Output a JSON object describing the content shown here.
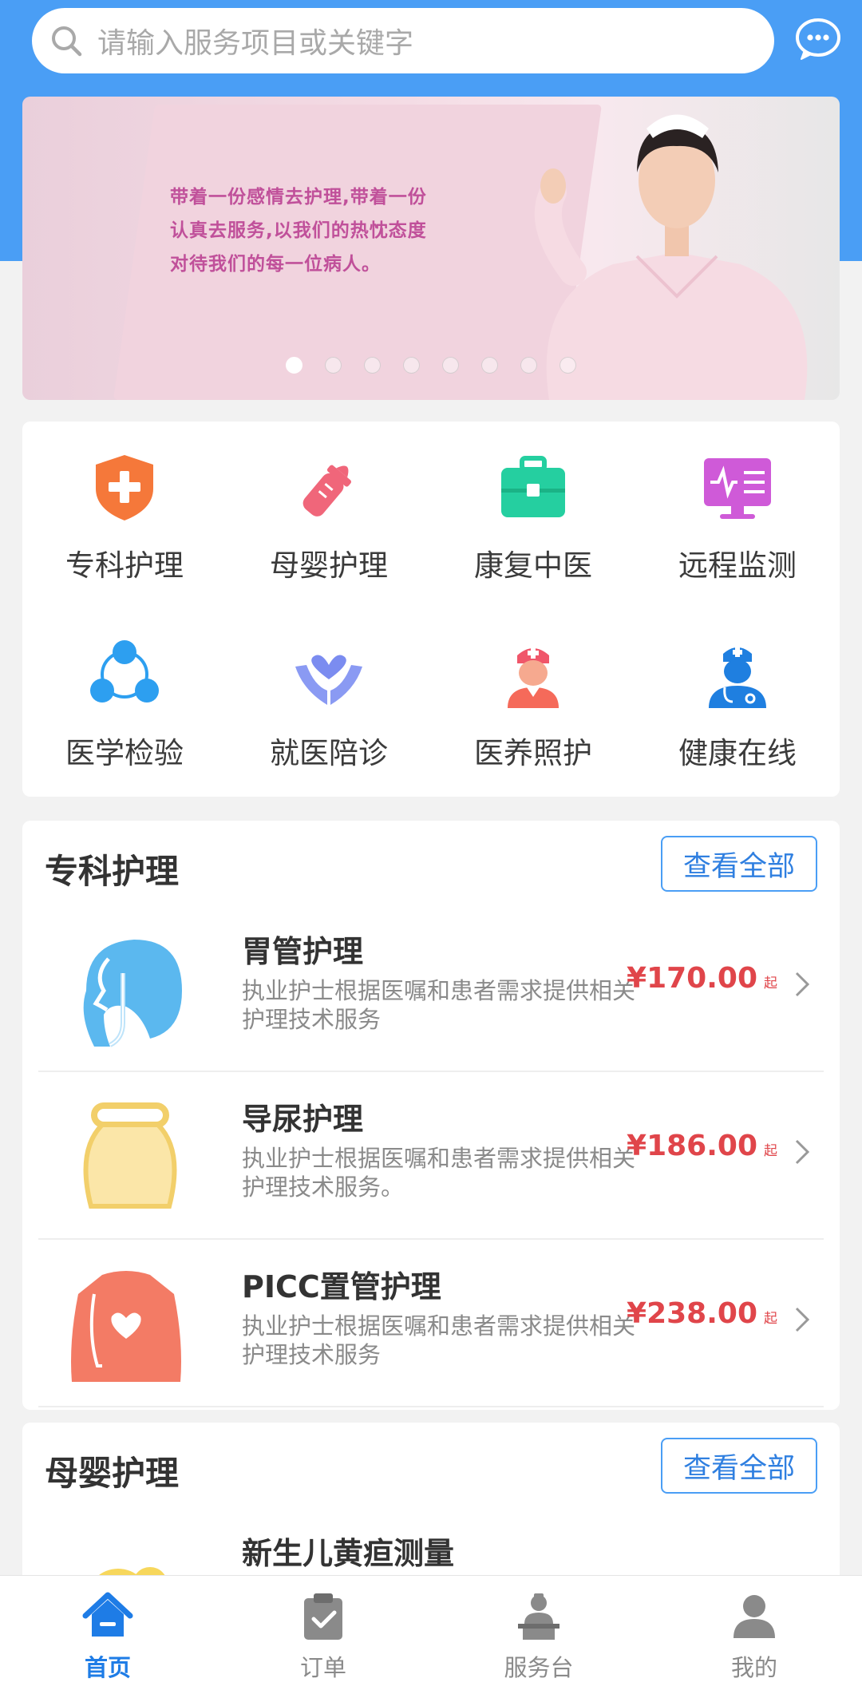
{
  "search": {
    "placeholder": "请输入服务项目或关键字"
  },
  "banner": {
    "lines": [
      "带着一份感情去护理,带着一份",
      "认真去服务,以我们的热忱态度",
      "对待我们的每一位病人。"
    ],
    "dots_total": 8,
    "dots_active_index": 0
  },
  "categories": [
    {
      "label": "专科护理",
      "icon": "shield-plus-icon",
      "color": "#f5783a"
    },
    {
      "label": "母婴护理",
      "icon": "baby-bottle-icon",
      "color": "#f0667a"
    },
    {
      "label": "康复中医",
      "icon": "medical-kit-icon",
      "color": "#25cfa0"
    },
    {
      "label": "远程监测",
      "icon": "monitor-ecg-icon",
      "color": "#cf5ad8"
    },
    {
      "label": "医学检验",
      "icon": "molecule-icon",
      "color": "#2d9ff0"
    },
    {
      "label": "就医陪诊",
      "icon": "hands-heart-icon",
      "color": "#7b8cf0"
    },
    {
      "label": "医养照护",
      "icon": "nurse-icon",
      "color": "#f56a5a"
    },
    {
      "label": "健康在线",
      "icon": "doctor-icon",
      "color": "#1f7fe0"
    }
  ],
  "sections": [
    {
      "title": "专科护理",
      "view_all": "查看全部",
      "items": [
        {
          "name": "胃管护理",
          "desc": "执业护士根据医嘱和患者需求提供相关护理技术服务",
          "price": "¥170.00",
          "unit": "起",
          "icon": "head-tube-icon"
        },
        {
          "name": "导尿护理",
          "desc": "执业护士根据医嘱和患者需求提供相关护理技术服务。",
          "price": "¥186.00",
          "unit": "起",
          "icon": "urine-bag-icon"
        },
        {
          "name": "PICC置管护理",
          "desc": "执业护士根据医嘱和患者需求提供相关护理技术服务",
          "price": "¥238.00",
          "unit": "起",
          "icon": "torso-picc-icon"
        }
      ]
    },
    {
      "title": "母婴护理",
      "view_all": "查看全部",
      "items": [
        {
          "name": "新生儿黄疸测量",
          "icon": "baby-icon"
        }
      ]
    }
  ],
  "tabs": [
    {
      "label": "首页",
      "icon": "home-icon",
      "active": true
    },
    {
      "label": "订单",
      "icon": "clipboard-check-icon",
      "active": false
    },
    {
      "label": "服务台",
      "icon": "service-desk-icon",
      "active": false
    },
    {
      "label": "我的",
      "icon": "user-icon",
      "active": false
    }
  ]
}
